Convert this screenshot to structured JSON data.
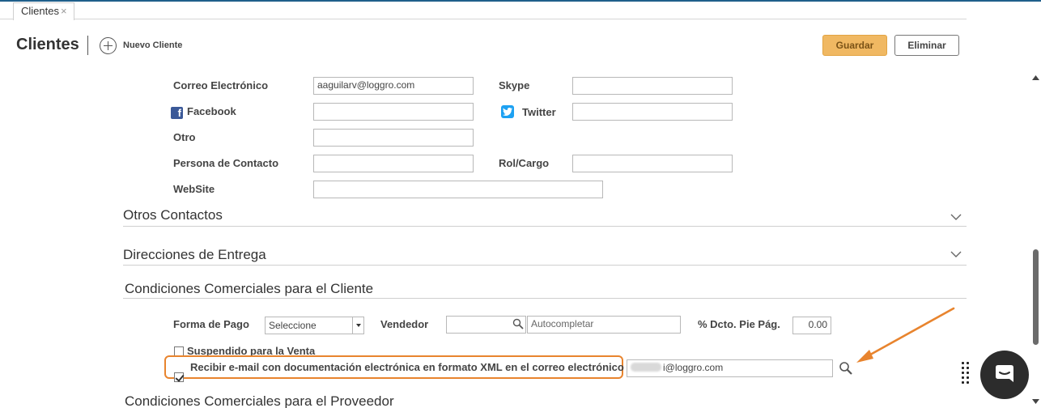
{
  "tab": {
    "label": "Clientes",
    "close": "×"
  },
  "header": {
    "title": "Clientes",
    "new_label": "Nuevo Cliente",
    "save_label": "Guardar",
    "delete_label": "Eliminar"
  },
  "contact": {
    "email_label": "Correo Electrónico",
    "email_value": "aaguilarv@loggro.com",
    "skype_label": "Skype",
    "skype_value": "",
    "facebook_label": "Facebook",
    "facebook_value": "",
    "twitter_label": "Twitter",
    "twitter_value": "",
    "other_label": "Otro",
    "other_value": "",
    "contact_person_label": "Persona de Contacto",
    "contact_person_value": "",
    "role_label": "Rol/Cargo",
    "role_value": "",
    "website_label": "WebSite",
    "website_value": ""
  },
  "sections": {
    "other_contacts": "Otros Contactos",
    "delivery_addresses": "Direcciones de Entrega",
    "commercial_conditions": "Condiciones Comerciales para el Cliente",
    "supplier_conditions": "Condiciones Comerciales para el Proveedor"
  },
  "commercial": {
    "payment_label": "Forma de Pago",
    "payment_value": "Seleccione",
    "seller_label": "Vendedor",
    "seller_code": "",
    "seller_placeholder": "Autocompletar",
    "discount_label": "% Dcto. Pie Pág.",
    "discount_value": "0.00",
    "suspended_label": "Suspendido para la Venta",
    "suspended_checked": false,
    "xml_email_label": "Recibir e-mail con documentación electrónica en formato XML en el correo electrónico",
    "xml_email_checked": true,
    "xml_email_value": "i@loggro.com"
  },
  "colors": {
    "accent_save": "#f0b862",
    "highlight": "#e8842e",
    "facebook": "#3b5998",
    "twitter": "#1da1f2"
  },
  "icons": {
    "add": "plus-circle-icon",
    "search": "magnifier-icon",
    "expand": "chevron-down-icon",
    "chat": "chat-bubble-icon"
  }
}
